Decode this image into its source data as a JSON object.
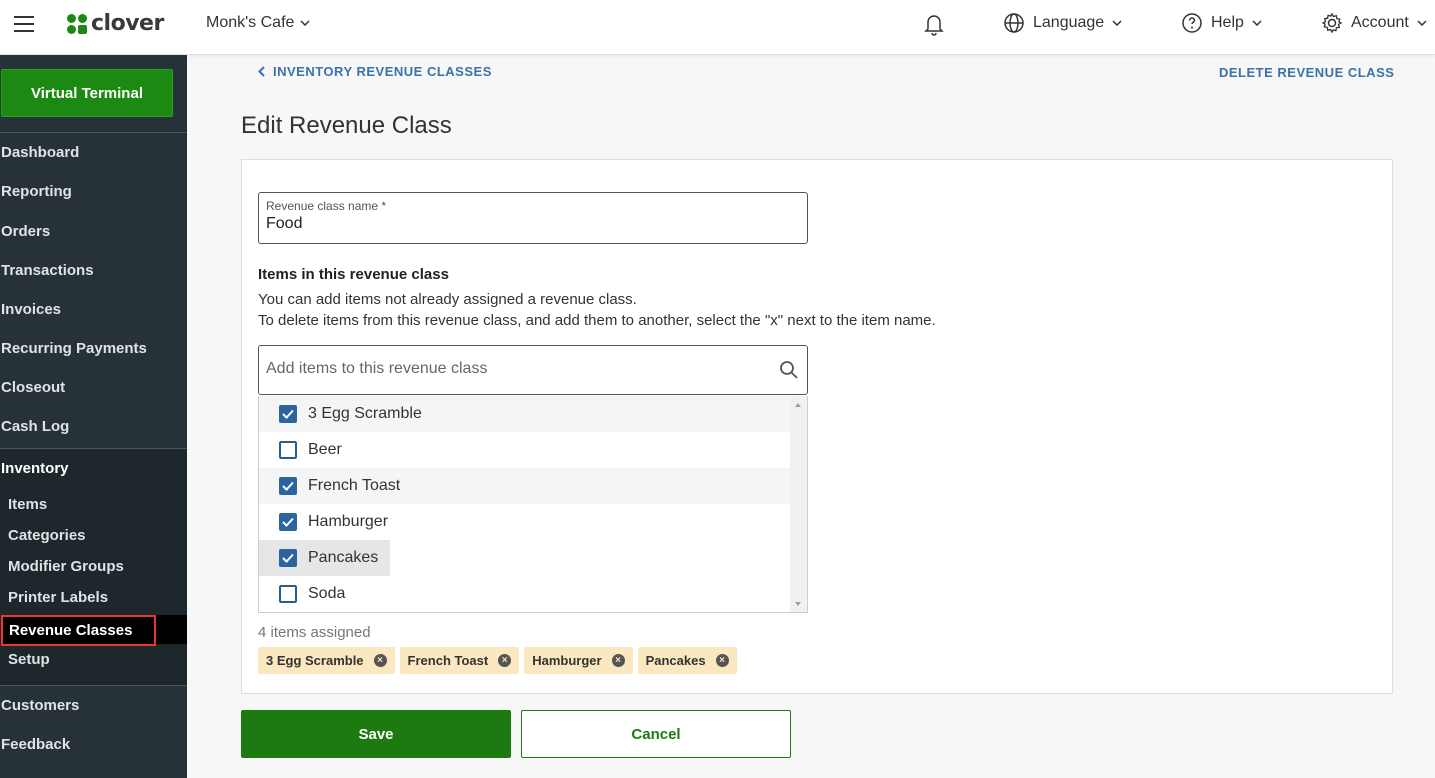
{
  "header": {
    "brand": "clover",
    "merchant": "Monk's Cafe",
    "language_label": "Language",
    "help_label": "Help",
    "account_label": "Account",
    "brand_color": "#1c8a12"
  },
  "sidebar": {
    "virtual_terminal": "Virtual Terminal",
    "items": [
      "Dashboard",
      "Reporting",
      "Orders",
      "Transactions",
      "Invoices",
      "Recurring Payments",
      "Closeout",
      "Cash Log"
    ],
    "inventory": {
      "label": "Inventory",
      "sub_items": [
        "Items",
        "Categories",
        "Modifier Groups",
        "Printer Labels",
        "Revenue Classes",
        "Setup"
      ],
      "active": "Revenue Classes"
    },
    "bottom_items": [
      "Customers",
      "Feedback"
    ]
  },
  "page": {
    "back_link": "INVENTORY REVENUE CLASSES",
    "delete_link": "DELETE REVENUE CLASS",
    "title": "Edit Revenue Class"
  },
  "form": {
    "name_label": "Revenue class name *",
    "name_value": "Food",
    "section_heading": "Items in this revenue class",
    "description_line1": "You can add items not already assigned a revenue class.",
    "description_line2": "To delete items from this revenue class, and add them to another, select the \"x\" next to the item name.",
    "search_placeholder": "Add items to this revenue class",
    "items": [
      {
        "label": "3 Egg Scramble",
        "checked": true
      },
      {
        "label": "Beer",
        "checked": false
      },
      {
        "label": "French Toast",
        "checked": true
      },
      {
        "label": "Hamburger",
        "checked": true
      },
      {
        "label": "Pancakes",
        "checked": true
      },
      {
        "label": "Soda",
        "checked": false
      }
    ],
    "assigned_count": "4 items assigned",
    "chips": [
      "3 Egg Scramble",
      "French Toast",
      "Hamburger",
      "Pancakes"
    ],
    "save_label": "Save",
    "cancel_label": "Cancel"
  }
}
